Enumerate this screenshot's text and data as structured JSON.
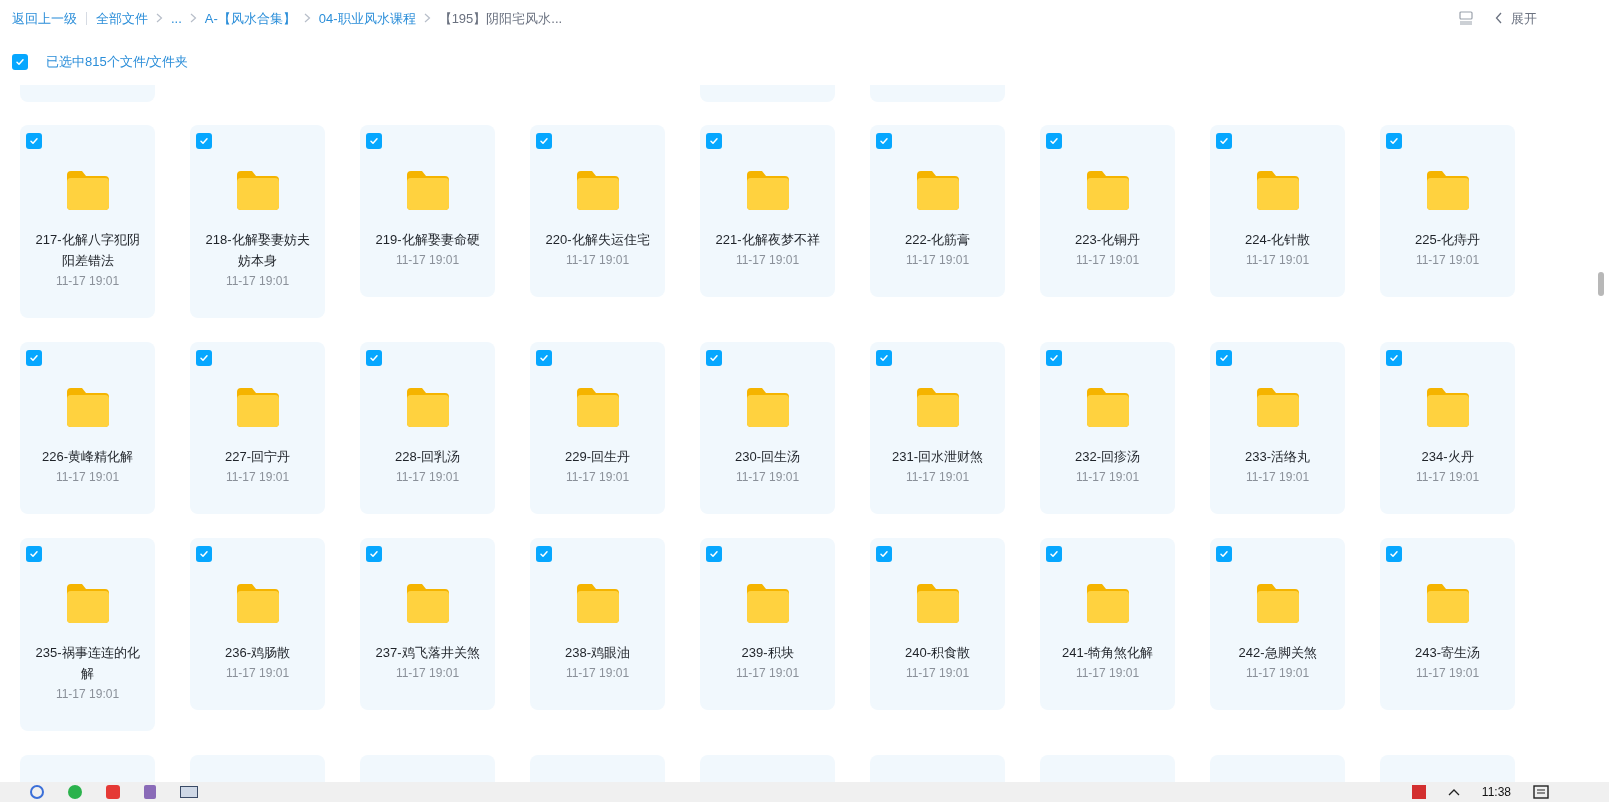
{
  "breadcrumbs": [
    {
      "label": "返回上一级",
      "kind": "link"
    },
    {
      "label": "全部文件",
      "kind": "link"
    },
    {
      "label": "...",
      "kind": "link"
    },
    {
      "label": "A-【风水合集】",
      "kind": "link"
    },
    {
      "label": "04-职业风水课程",
      "kind": "link"
    },
    {
      "label": "【195】阴阳宅风水...",
      "kind": "current"
    }
  ],
  "toolbar": {
    "expand_label": "展开"
  },
  "selection": {
    "checked": true,
    "label": "已选中815个文件/文件夹"
  },
  "rows": [
    [
      {
        "name": "217-化解八字犯阴阳差错法",
        "date": "11-17 19:01",
        "selected": true
      },
      {
        "name": "218-化解娶妻妨夫妨本身",
        "date": "11-17 19:01",
        "selected": true
      },
      {
        "name": "219-化解娶妻命硬",
        "date": "11-17 19:01",
        "selected": true
      },
      {
        "name": "220-化解失运住宅",
        "date": "11-17 19:01",
        "selected": true
      },
      {
        "name": "221-化解夜梦不祥",
        "date": "11-17 19:01",
        "selected": true
      },
      {
        "name": "222-化筋膏",
        "date": "11-17 19:01",
        "selected": true
      },
      {
        "name": "223-化铜丹",
        "date": "11-17 19:01",
        "selected": true
      },
      {
        "name": "224-化针散",
        "date": "11-17 19:01",
        "selected": true
      },
      {
        "name": "225-化痔丹",
        "date": "11-17 19:01",
        "selected": true
      }
    ],
    [
      {
        "name": "226-黄峰精化解",
        "date": "11-17 19:01",
        "selected": true
      },
      {
        "name": "227-回宁丹",
        "date": "11-17 19:01",
        "selected": true
      },
      {
        "name": "228-回乳汤",
        "date": "11-17 19:01",
        "selected": true
      },
      {
        "name": "229-回生丹",
        "date": "11-17 19:01",
        "selected": true
      },
      {
        "name": "230-回生汤",
        "date": "11-17 19:01",
        "selected": true
      },
      {
        "name": "231-回水泄财煞",
        "date": "11-17 19:01",
        "selected": true
      },
      {
        "name": "232-回疹汤",
        "date": "11-17 19:01",
        "selected": true
      },
      {
        "name": "233-活络丸",
        "date": "11-17 19:01",
        "selected": true
      },
      {
        "name": "234-火丹",
        "date": "11-17 19:01",
        "selected": true
      }
    ],
    [
      {
        "name": "235-祸事连连的化解",
        "date": "11-17 19:01",
        "selected": true
      },
      {
        "name": "236-鸡肠散",
        "date": "11-17 19:01",
        "selected": true
      },
      {
        "name": "237-鸡飞落井关煞",
        "date": "11-17 19:01",
        "selected": true
      },
      {
        "name": "238-鸡眼油",
        "date": "11-17 19:01",
        "selected": true
      },
      {
        "name": "239-积块",
        "date": "11-17 19:01",
        "selected": true
      },
      {
        "name": "240-积食散",
        "date": "11-17 19:01",
        "selected": true
      },
      {
        "name": "241-犄角煞化解",
        "date": "11-17 19:01",
        "selected": true
      },
      {
        "name": "242-急脚关煞",
        "date": "11-17 19:01",
        "selected": true
      },
      {
        "name": "243-寄生汤",
        "date": "11-17 19:01",
        "selected": true
      }
    ]
  ],
  "taskbar": {
    "clock": "11:38"
  }
}
